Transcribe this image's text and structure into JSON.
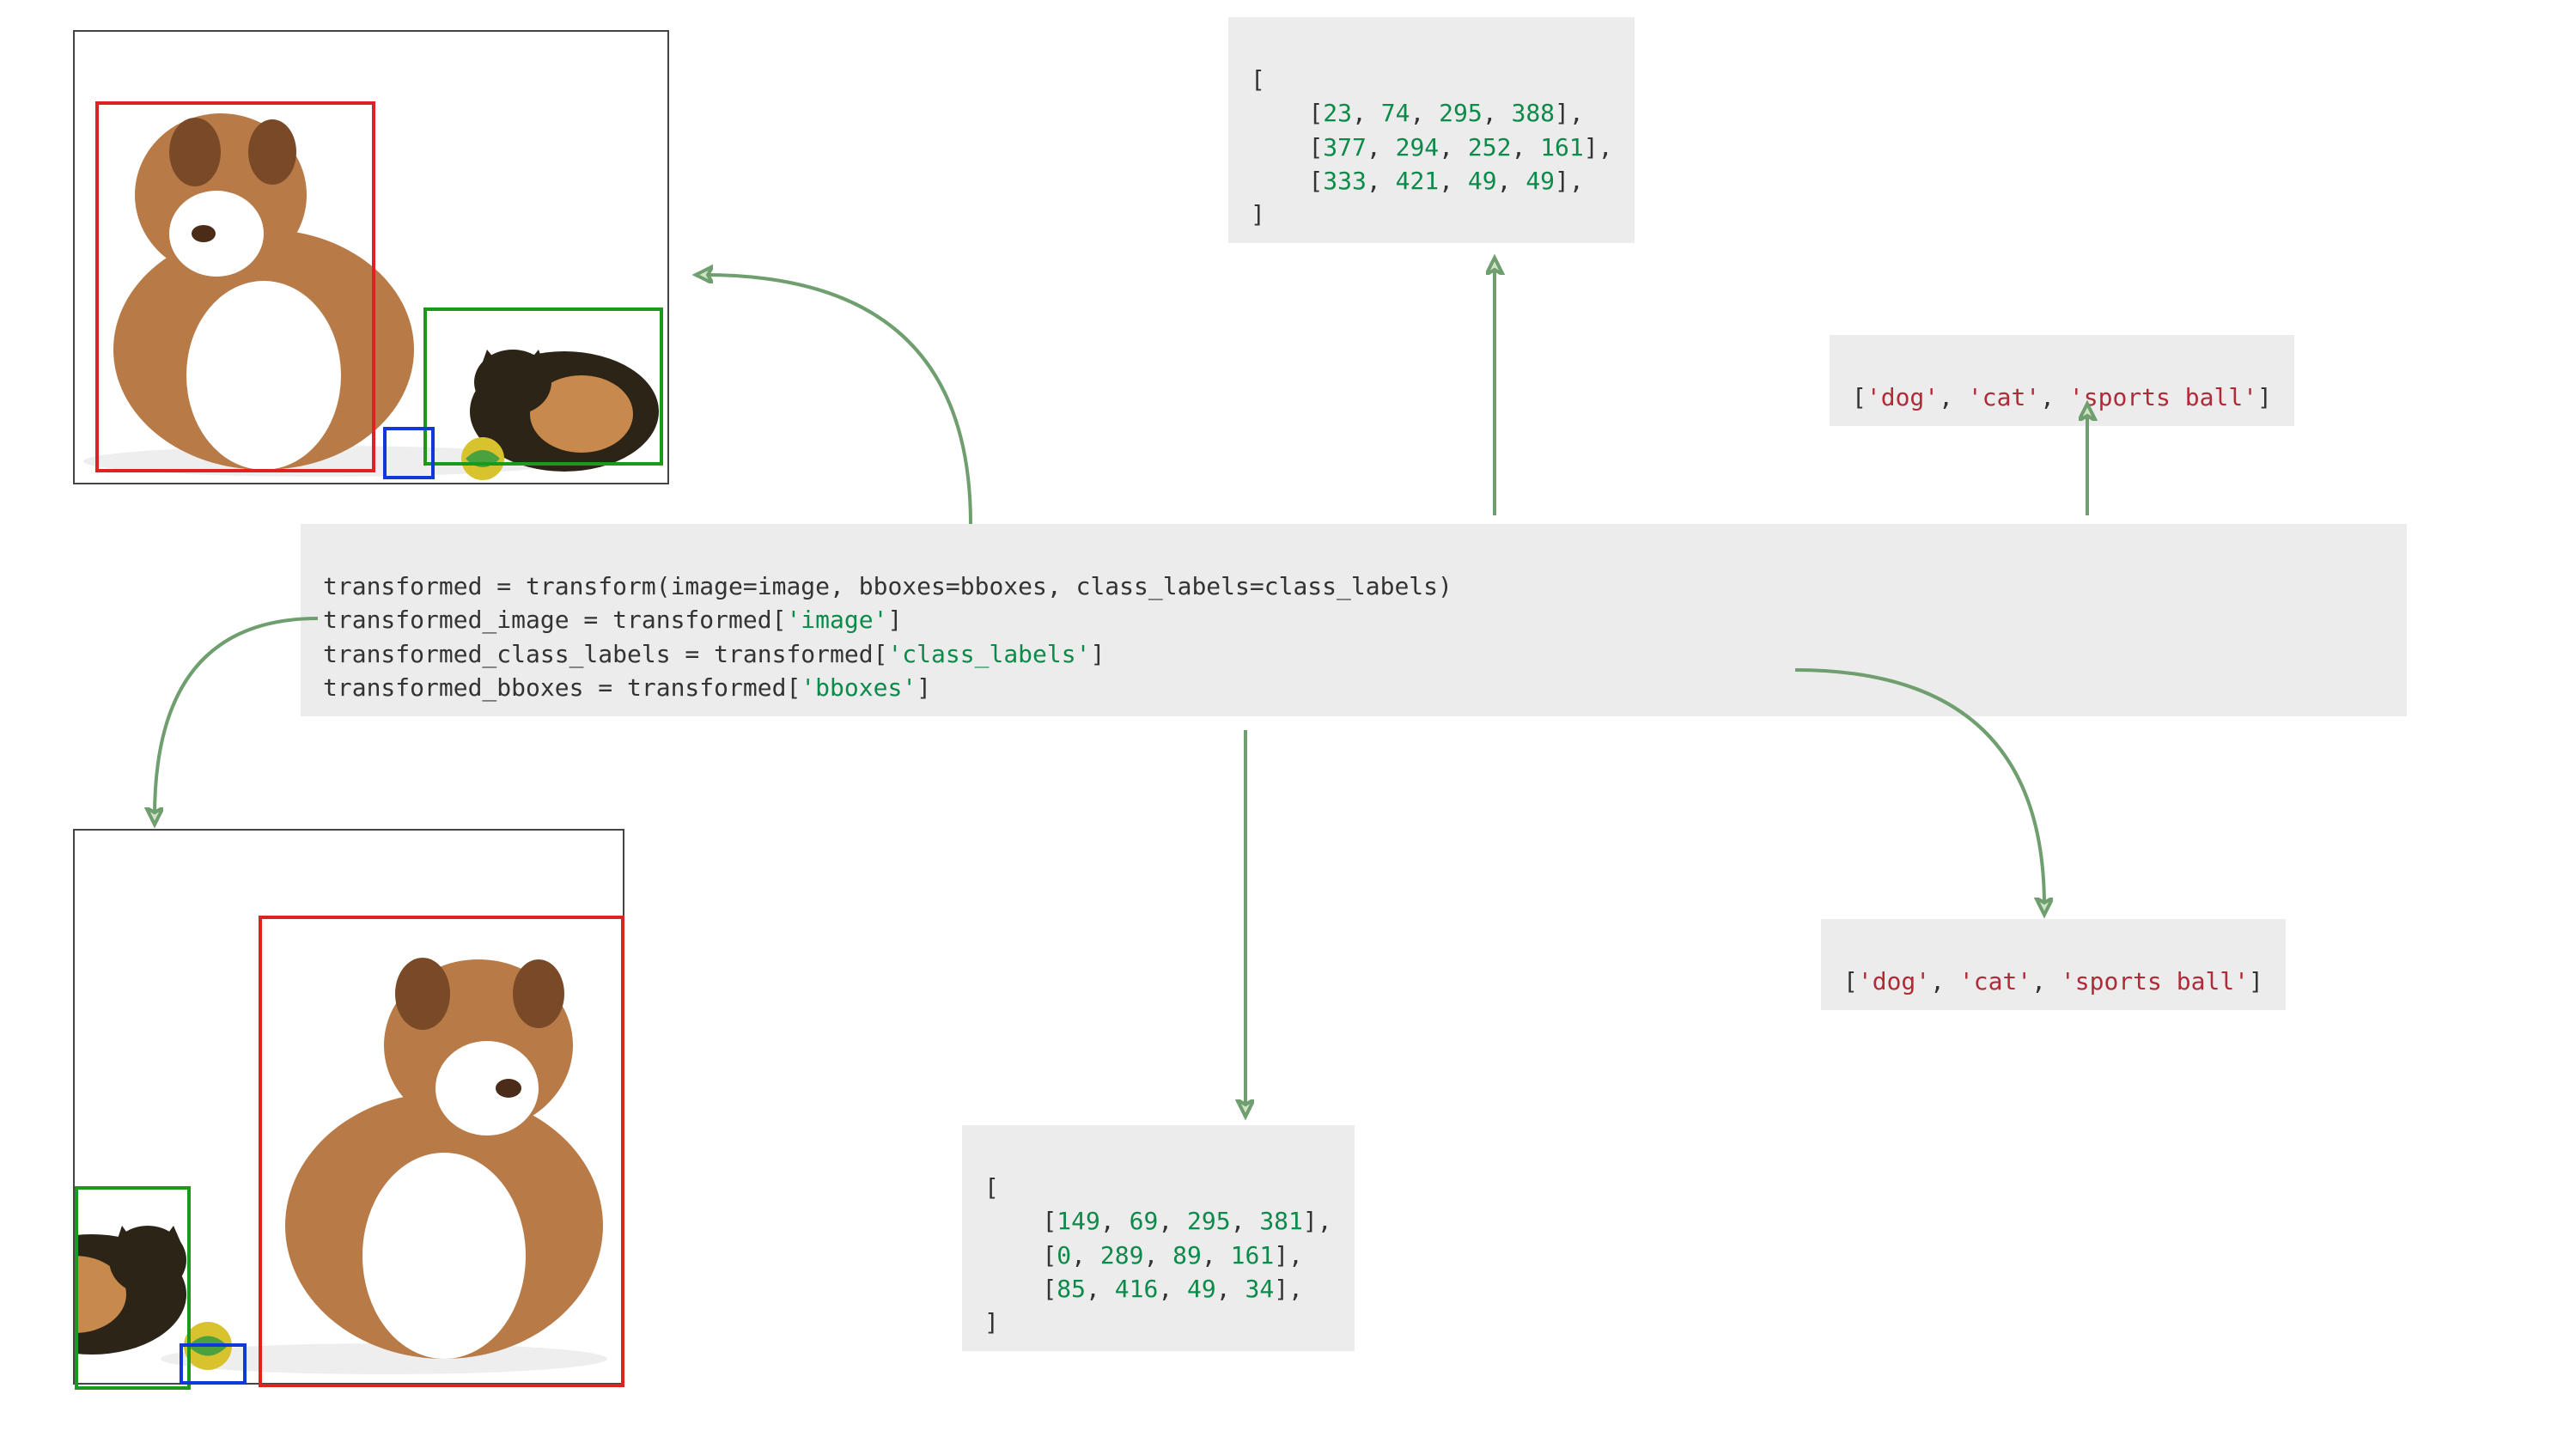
{
  "input": {
    "bboxes_header": "[",
    "bboxes_row0_a": "[",
    "bboxes_row0_0": "23",
    "bboxes_row0_s0": ", ",
    "bboxes_row0_1": "74",
    "bboxes_row0_s1": ", ",
    "bboxes_row0_2": "295",
    "bboxes_row0_s2": ", ",
    "bboxes_row0_3": "388",
    "bboxes_row0_b": "],",
    "bboxes_row1_a": "[",
    "bboxes_row1_0": "377",
    "bboxes_row1_s0": ", ",
    "bboxes_row1_1": "294",
    "bboxes_row1_s1": ", ",
    "bboxes_row1_2": "252",
    "bboxes_row1_s2": ", ",
    "bboxes_row1_3": "161",
    "bboxes_row1_b": "],",
    "bboxes_row2_a": "[",
    "bboxes_row2_0": "333",
    "bboxes_row2_s0": ", ",
    "bboxes_row2_1": "421",
    "bboxes_row2_s1": ", ",
    "bboxes_row2_2": "49",
    "bboxes_row2_s2": ", ",
    "bboxes_row2_3": "49",
    "bboxes_row2_b": "],",
    "bboxes_footer": "]",
    "labels_open": "[",
    "labels_0": "'dog'",
    "labels_s0": ", ",
    "labels_1": "'cat'",
    "labels_s1": ", ",
    "labels_2": "'sports ball'",
    "labels_close": "]"
  },
  "code": {
    "l1a": "transformed = transform(image=image, bboxes=bboxes, class_labels=class_labels)",
    "l2a": "transformed_image = transformed[",
    "l2b": "'image'",
    "l2c": "]",
    "l3a": "transformed_class_labels = transformed[",
    "l3b": "'class_labels'",
    "l3c": "]",
    "l4a": "transformed_bboxes = transformed[",
    "l4b": "'bboxes'",
    "l4c": "]"
  },
  "output": {
    "bboxes_header": "[",
    "bboxes_row0_a": "[",
    "bboxes_row0_0": "149",
    "bboxes_row0_s0": ", ",
    "bboxes_row0_1": "69",
    "bboxes_row0_s1": ", ",
    "bboxes_row0_2": "295",
    "bboxes_row0_s2": ", ",
    "bboxes_row0_3": "381",
    "bboxes_row0_b": "],",
    "bboxes_row1_a": "[",
    "bboxes_row1_0": "0",
    "bboxes_row1_s0": ", ",
    "bboxes_row1_1": "289",
    "bboxes_row1_s1": ", ",
    "bboxes_row1_2": "89",
    "bboxes_row1_s2": ", ",
    "bboxes_row1_3": "161",
    "bboxes_row1_b": "],",
    "bboxes_row2_a": "[",
    "bboxes_row2_0": "85",
    "bboxes_row2_s0": ", ",
    "bboxes_row2_1": "416",
    "bboxes_row2_s1": ", ",
    "bboxes_row2_2": "49",
    "bboxes_row2_s2": ", ",
    "bboxes_row2_3": "34",
    "bboxes_row2_b": "],",
    "bboxes_footer": "]",
    "labels_open": "[",
    "labels_0": "'dog'",
    "labels_s0": ", ",
    "labels_1": "'cat'",
    "labels_s1": ", ",
    "labels_2": "'sports ball'",
    "labels_close": "]"
  },
  "chart_data": {
    "type": "table",
    "input_bboxes": [
      [
        23,
        74,
        295,
        388
      ],
      [
        377,
        294,
        252,
        161
      ],
      [
        333,
        421,
        49,
        49
      ]
    ],
    "input_class_labels": [
      "dog",
      "cat",
      "sports ball"
    ],
    "output_bboxes": [
      [
        149,
        69,
        295,
        381
      ],
      [
        0,
        289,
        89,
        161
      ],
      [
        85,
        416,
        49,
        34
      ]
    ],
    "output_class_labels": [
      "dog",
      "cat",
      "sports ball"
    ]
  }
}
